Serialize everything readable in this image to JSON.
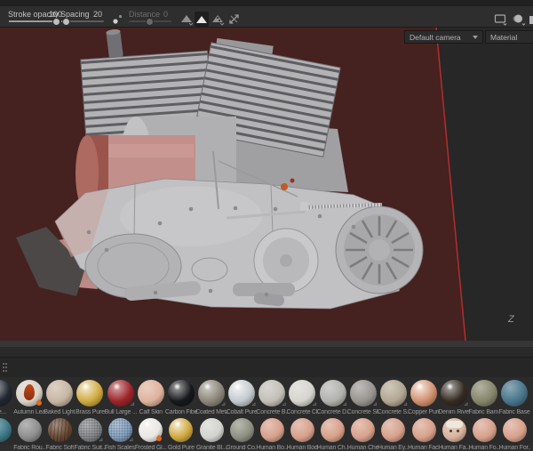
{
  "toolbar": {
    "stroke_opacity": {
      "label": "Stroke opacity",
      "value": "100"
    },
    "spacing": {
      "label": "Spacing",
      "value": "20"
    },
    "distance": {
      "label": "Distance",
      "value": "0",
      "disabled": true
    },
    "icons": [
      "brush-falloff-icon",
      "falloff-triangle-icon",
      "falloff-solid-icon",
      "falloff-dots-icon",
      "symmetry-icon"
    ]
  },
  "viewport": {
    "camera_dropdown": "Default camera",
    "shader_dropdown": "Material",
    "z_label": "Z",
    "corner_icons": [
      "display-settings-icon",
      "environment-sphere-icon",
      "panel-icon"
    ],
    "colors": {
      "backdrop": "#45211f",
      "backdrop_edge": "#b02e2e",
      "panel_bg": "#272727",
      "model_gray": "#c1c1c4"
    }
  },
  "shelf": {
    "rows": [
      {
        "items": [
          {
            "label": "l Le...",
            "color": "#232831",
            "sheen": "gloss"
          },
          {
            "label": "Autumn Leaf",
            "color": "#d8d2c8",
            "sheen": "matte",
            "decor": "leaf",
            "badge": "flame"
          },
          {
            "label": "Baked Light...",
            "color": "#c7b5a2",
            "sheen": "matte"
          },
          {
            "label": "Brass Pure",
            "color": "#cfa93f",
            "sheen": "metal"
          },
          {
            "label": "Bull Large ...",
            "color": "#9c2328",
            "sheen": "gloss",
            "badge": "mark"
          },
          {
            "label": "Calf Skin",
            "color": "#dfb29c",
            "sheen": "matte"
          },
          {
            "label": "Carbon Fiber",
            "color": "#17181c",
            "sheen": "gloss"
          },
          {
            "label": "Coated Metal",
            "color": "#8a8578",
            "sheen": "gloss",
            "badge": "mark"
          },
          {
            "label": "Cobalt Pure",
            "color": "#c3c8cd",
            "sheen": "metal",
            "badge": "mark"
          },
          {
            "label": "Concrete B...",
            "color": "#c2bfb8",
            "sheen": "matte",
            "badge": "mark"
          },
          {
            "label": "Concrete Cl...",
            "color": "#d6d4ce",
            "sheen": "matte",
            "badge": "mark"
          },
          {
            "label": "Concrete D...",
            "color": "#b2b1ad",
            "sheen": "matte",
            "badge": "mark"
          },
          {
            "label": "Concrete Sl...",
            "color": "#97948f",
            "sheen": "matte",
            "badge": "mark"
          },
          {
            "label": "Concrete S...",
            "color": "#b2a692",
            "sheen": "matte",
            "badge": "mark"
          },
          {
            "label": "Copper Pure",
            "color": "#d08f6e",
            "sheen": "metal"
          },
          {
            "label": "Denim Rivet",
            "color": "#352b22",
            "sheen": "gloss",
            "badge": "mark"
          },
          {
            "label": "Fabric Bam...",
            "color": "#85856a",
            "sheen": "matte"
          },
          {
            "label": "Fabric Base...",
            "color": "#47758a",
            "sheen": "matte"
          }
        ]
      },
      {
        "items": [
          {
            "label": "",
            "color": "#3d7787",
            "sheen": "matte"
          },
          {
            "label": "Fabric Rou...",
            "color": "#8d8d8d",
            "sheen": "matte"
          },
          {
            "label": "Fabric Soft",
            "color": "#6b4a35",
            "sheen": "matte",
            "decor": "grain"
          },
          {
            "label": "Fabric Suit...",
            "color": "#878a8d",
            "sheen": "matte",
            "decor": "weave",
            "badge": "mark"
          },
          {
            "label": "Fish Scales...",
            "color": "#86a2c2",
            "sheen": "matte",
            "decor": "weave",
            "badge": "mark"
          },
          {
            "label": "Frosted Gl...",
            "color": "#e9e7e2",
            "sheen": "gloss",
            "badge": "flame"
          },
          {
            "label": "Gold Pure",
            "color": "#cfa73e",
            "sheen": "metal"
          },
          {
            "label": "Granite Bl...",
            "color": "#d2d2cf",
            "sheen": "matte"
          },
          {
            "label": "Ground Co...",
            "color": "#8c9080",
            "sheen": "matte"
          },
          {
            "label": "Human Bo...",
            "color": "#d7a08b",
            "sheen": "matte"
          },
          {
            "label": "Human Bod...",
            "color": "#d7a08b",
            "sheen": "matte"
          },
          {
            "label": "Human Ch...",
            "color": "#d7a08b",
            "sheen": "matte"
          },
          {
            "label": "Human Che...",
            "color": "#d7a08b",
            "sheen": "matte"
          },
          {
            "label": "Human Ey...",
            "color": "#d7a08b",
            "sheen": "matte"
          },
          {
            "label": "Human Fac...",
            "color": "#d7a08b",
            "sheen": "matte"
          },
          {
            "label": "Human Fa...",
            "color": "#d8b39e",
            "sheen": "matte",
            "decor": "face"
          },
          {
            "label": "Human Fo...",
            "color": "#d7a08b",
            "sheen": "matte"
          },
          {
            "label": "Human For...",
            "color": "#d7a08b",
            "sheen": "matte"
          }
        ]
      }
    ]
  }
}
